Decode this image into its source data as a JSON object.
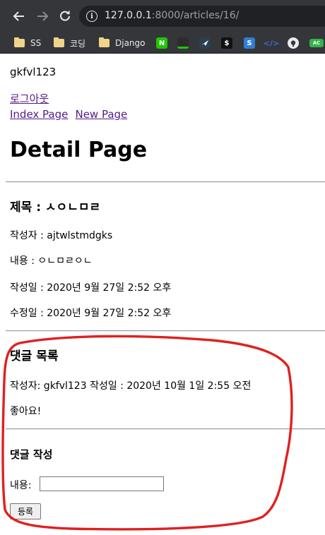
{
  "browser": {
    "url_host": "127.0.0.1",
    "url_path": ":8000/articles/16/",
    "bookmarks": [
      {
        "label": "SS"
      },
      {
        "label": "코딩"
      },
      {
        "label": "Django"
      },
      {
        "label": "N"
      }
    ]
  },
  "page": {
    "username": "gkfvl123",
    "logout_label": "로그아웃",
    "index_link": "Index Page",
    "new_link": "New Page",
    "title": "Detail Page",
    "article": {
      "title_line": "제목 : ㅅㅇㄴㅁㄹ",
      "author_line": "작성자 : ajtwlstmdgks",
      "content_line": "내용 : ㅇㄴㅁㄹㅇㄴ",
      "created_line": "작성일 : 2020년 9월 27일 2:52 오후",
      "updated_line": "수정일 : 2020년 9월 27일 2:52 오후"
    },
    "comments": {
      "heading": "댓글 목록",
      "items": [
        {
          "meta": "작성자: gkfvl123 작성일 : 2020년 10월 1일 2:55 오전",
          "content": "좋아요!"
        }
      ]
    },
    "comment_form": {
      "heading": "댓글 작성",
      "content_label": "내용:",
      "content_value": "",
      "submit_label": "등록"
    }
  },
  "colors": {
    "browser_chrome": "#35363a",
    "link": "#551a8b",
    "annotation": "#e02020"
  }
}
